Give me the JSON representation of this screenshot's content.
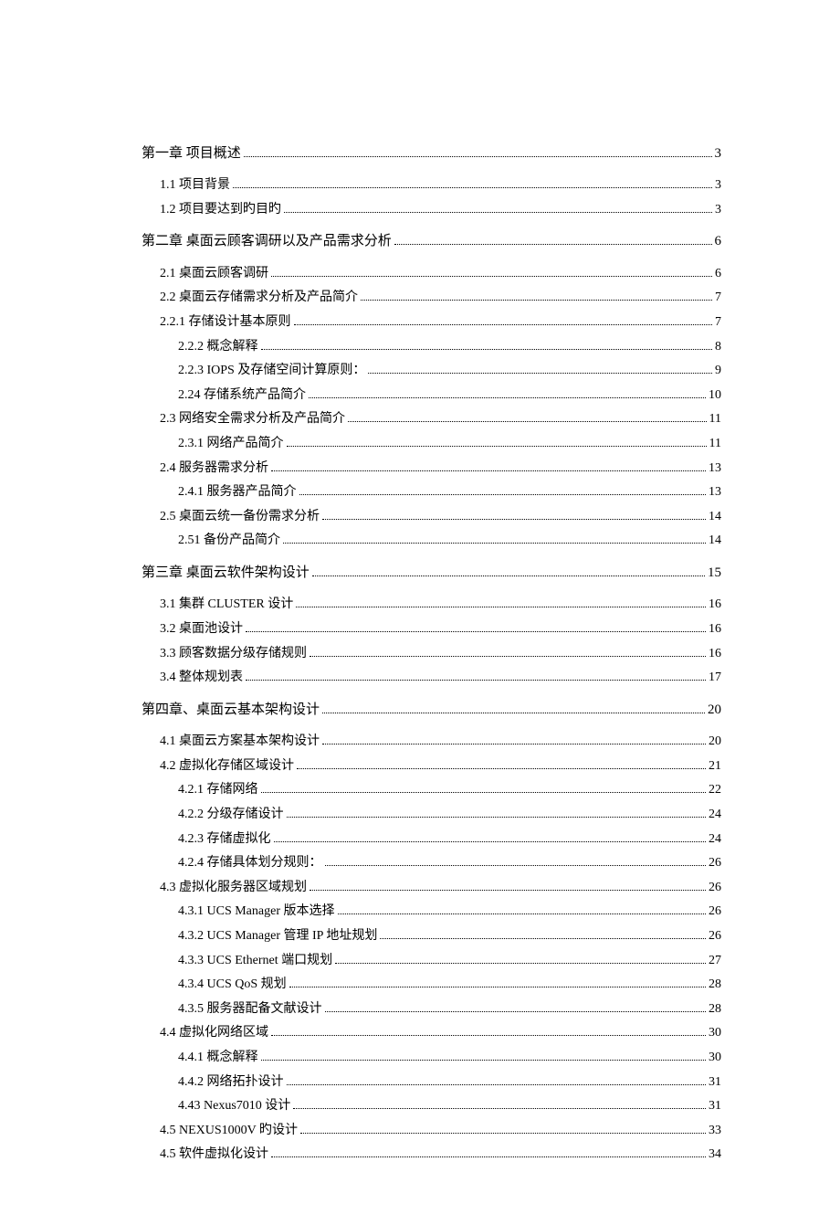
{
  "toc": [
    {
      "level": 0,
      "title": "第一章   项目概述",
      "page": "3"
    },
    {
      "level": 1,
      "title": "1.1 项目背景",
      "page": "3"
    },
    {
      "level": 1,
      "title": "1.2 项目要达到旳目旳",
      "page": "3"
    },
    {
      "level": 0,
      "title": "第二章 桌面云顾客调研以及产品需求分析",
      "page": "6"
    },
    {
      "level": 1,
      "title": "2.1 桌面云顾客调研",
      "page": "6"
    },
    {
      "level": 1,
      "title": "2.2 桌面云存储需求分析及产品简介",
      "page": "7"
    },
    {
      "level": 1,
      "title": "2.2.1 存储设计基本原则",
      "page": "7"
    },
    {
      "level": 2,
      "title": "2.2.2 概念解释",
      "page": "8"
    },
    {
      "level": 2,
      "title": "2.2.3 IOPS 及存储空间计算原则：",
      "page": "9"
    },
    {
      "level": 2,
      "title": "2.24 存储系统产品简介",
      "page": "10"
    },
    {
      "level": 1,
      "title": "2.3 网络安全需求分析及产品简介",
      "page": "11"
    },
    {
      "level": 2,
      "title": "2.3.1 网络产品简介",
      "page": "11"
    },
    {
      "level": 1,
      "title": "2.4 服务器需求分析",
      "page": "13"
    },
    {
      "level": 2,
      "title": "2.4.1 服务器产品简介",
      "page": "13"
    },
    {
      "level": 1,
      "title": "2.5 桌面云统一备份需求分析",
      "page": "14"
    },
    {
      "level": 2,
      "title": "2.51 备份产品简介",
      "page": "14"
    },
    {
      "level": 0,
      "title": "第三章 桌面云软件架构设计",
      "page": "15"
    },
    {
      "level": 1,
      "title": "3.1    集群 CLUSTER 设计",
      "page": "16"
    },
    {
      "level": 1,
      "title": "3.2  桌面池设计",
      "page": "16"
    },
    {
      "level": 1,
      "title": "3.3 顾客数据分级存储规则",
      "page": "16"
    },
    {
      "level": 1,
      "title": "3.4 整体规划表",
      "page": "17"
    },
    {
      "level": 0,
      "title": "第四章、桌面云基本架构设计",
      "page": "20"
    },
    {
      "level": 1,
      "title": "4.1 桌面云方案基本架构设计",
      "page": "20"
    },
    {
      "level": 1,
      "title": "4.2 虚拟化存储区域设计",
      "page": "21"
    },
    {
      "level": 2,
      "title": "4.2.1 存储网络",
      "page": "22"
    },
    {
      "level": 2,
      "title": "4.2.2  分级存储设计",
      "page": "24"
    },
    {
      "level": 2,
      "title": "4.2.3  存储虚拟化",
      "page": "24"
    },
    {
      "level": 2,
      "title": "4.2.4  存储具体划分规则：",
      "page": "26"
    },
    {
      "level": 1,
      "title": "4.3  虚拟化服务器区域规划",
      "page": "26"
    },
    {
      "level": 2,
      "title": "4.3.1 UCS Manager 版本选择",
      "page": "26"
    },
    {
      "level": 2,
      "title": "4.3.2 UCS Manager 管理 IP 地址规划",
      "page": "26"
    },
    {
      "level": 2,
      "title": "4.3.3  UCS Ethernet 端口规划",
      "page": "27"
    },
    {
      "level": 2,
      "title": "4.3.4 UCS QoS 规划",
      "page": "28"
    },
    {
      "level": 2,
      "title": "4.3.5 服务器配备文献设计",
      "page": "28"
    },
    {
      "level": 1,
      "title": "4.4 虚拟化网络区域",
      "page": "30"
    },
    {
      "level": 2,
      "title": "4.4.1 概念解释",
      "page": "30"
    },
    {
      "level": 2,
      "title": "4.4.2 网络拓扑设计",
      "page": "31"
    },
    {
      "level": 2,
      "title": "4.43 Nexus7010 设计",
      "page": "31"
    },
    {
      "level": 1,
      "title": "4.5 NEXUS1000V 旳设计",
      "page": "33"
    },
    {
      "level": 1,
      "title": "4.5 软件虚拟化设计",
      "page": "34"
    }
  ]
}
